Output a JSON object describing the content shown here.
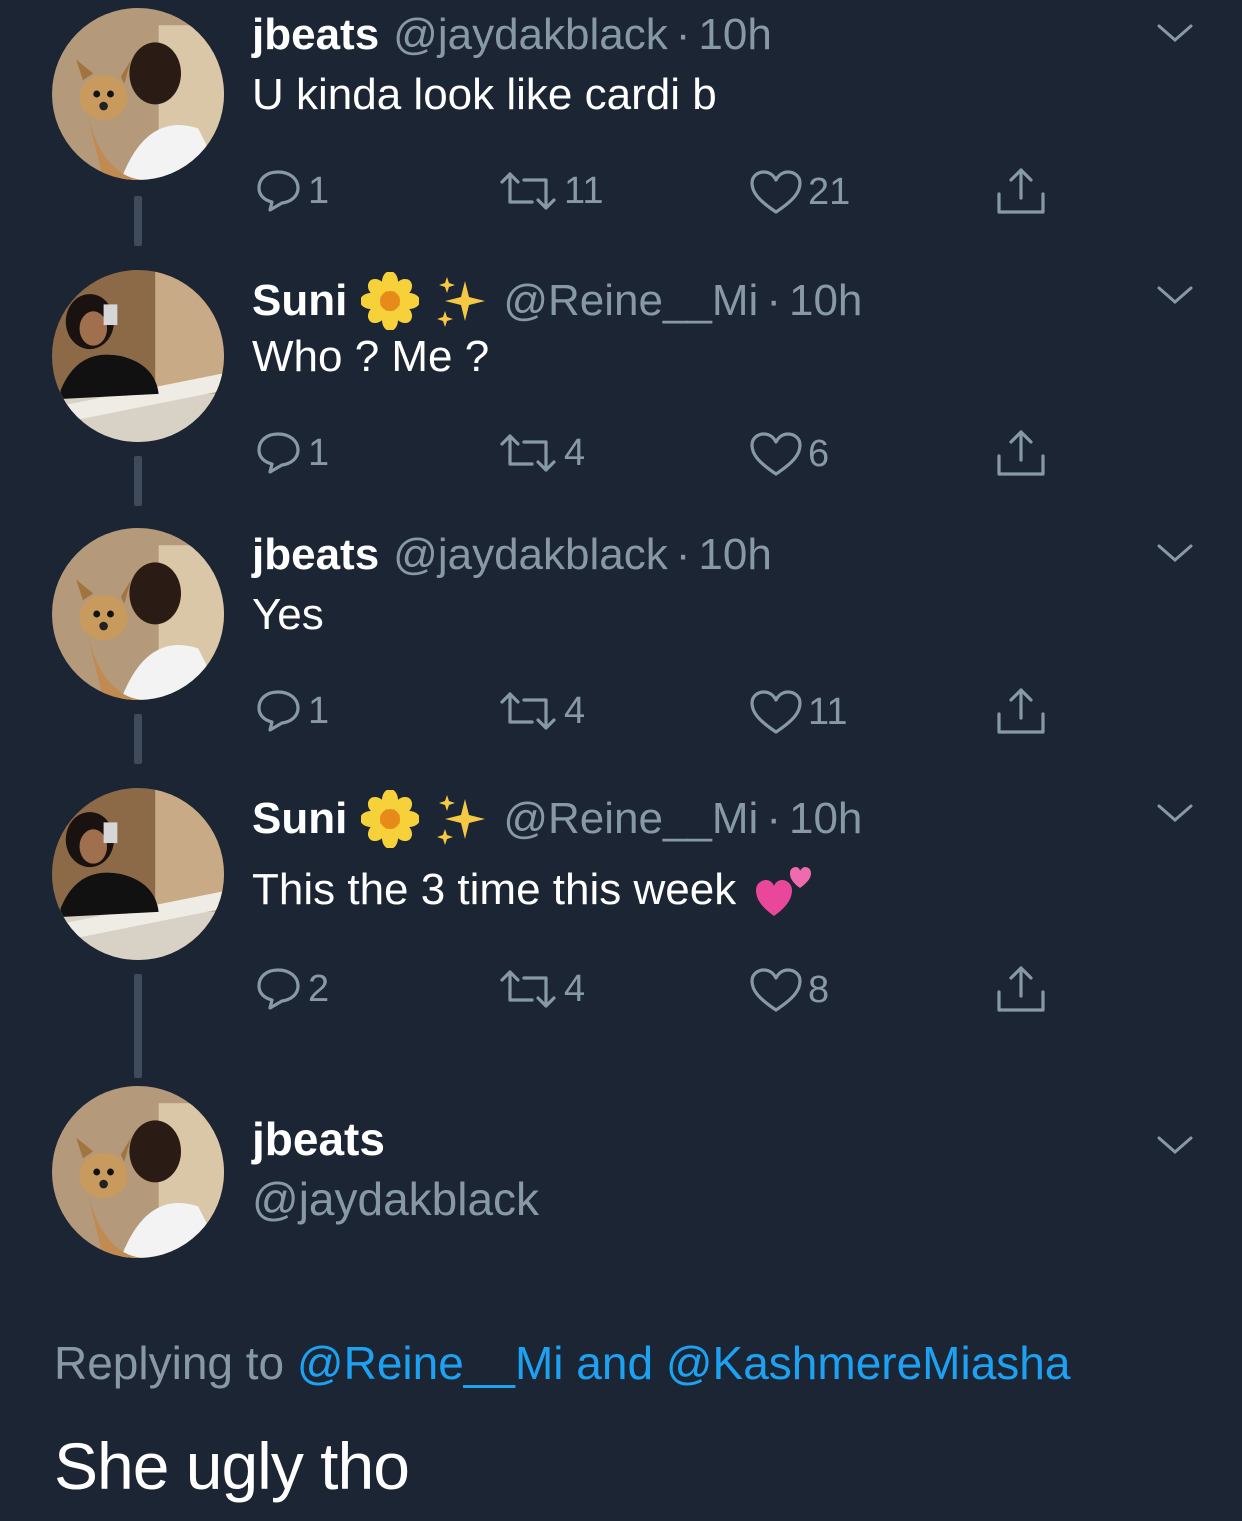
{
  "colors": {
    "background": "#1c2533",
    "secondary_text": "#8899a6",
    "link": "#1da1f2",
    "thread_line": "#3f4b5b"
  },
  "tweets": [
    {
      "name": "jbeats",
      "handle": "@jaydakblack",
      "dot": "·",
      "time": "10h",
      "text": "U kinda look like cardi b",
      "replies": "1",
      "retweets": "11",
      "likes": "21",
      "emojis": [],
      "avatar": "avatar-man-with-dog"
    },
    {
      "name": "Suni",
      "handle": "@Reine__Mi",
      "dot": "·",
      "time": "10h",
      "text": "Who ? Me ?",
      "replies": "1",
      "retweets": "4",
      "likes": "6",
      "emojis": [
        "blossom-emoji",
        "sparkles-emoji"
      ],
      "avatar": "avatar-woman-selfie"
    },
    {
      "name": "jbeats",
      "handle": "@jaydakblack",
      "dot": "·",
      "time": "10h",
      "text": "Yes",
      "replies": "1",
      "retweets": "4",
      "likes": "11",
      "emojis": [],
      "avatar": "avatar-man-with-dog"
    },
    {
      "name": "Suni",
      "handle": "@Reine__Mi",
      "dot": "·",
      "time": "10h",
      "text": "This the 3 time this week",
      "replies": "2",
      "retweets": "4",
      "likes": "8",
      "emojis": [
        "blossom-emoji",
        "sparkles-emoji"
      ],
      "text_emoji": "two-hearts-emoji",
      "avatar": "avatar-woman-selfie"
    }
  ],
  "main_tweet": {
    "name": "jbeats",
    "handle": "@jaydakblack",
    "replying_prefix": "Replying to",
    "replying_user1": "@Reine__Mi",
    "replying_and": "and",
    "replying_user2": "@KashmereMiasha",
    "text": "She ugly tho"
  },
  "icons": {
    "reply": "reply-icon",
    "retweet": "retweet-icon",
    "like": "heart-icon",
    "share": "share-icon",
    "more": "chevron-down-icon"
  }
}
